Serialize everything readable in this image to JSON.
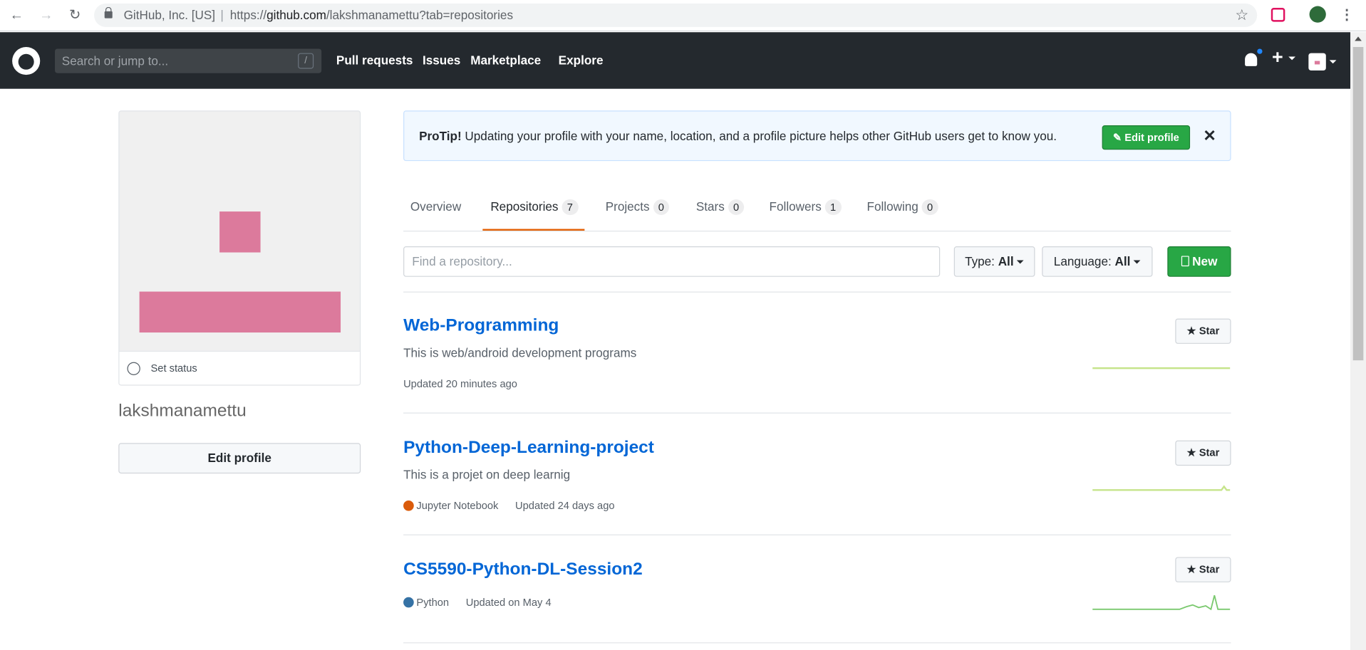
{
  "browser": {
    "org": "GitHub, Inc. [US]",
    "url_prefix": "https://",
    "url_host": "github.com",
    "url_path": "/lakshmanamettu?tab=repositories",
    "icons": [
      "back-arrow-icon",
      "forward-arrow-icon",
      "reload-icon",
      "lock-icon",
      "bookmark-star-icon",
      "pocket-extension-icon",
      "profile-avatar-icon",
      "kebab-menu-icon"
    ]
  },
  "header": {
    "search_placeholder": "Search or jump to...",
    "search_shortcut": "/",
    "nav": [
      "Pull requests",
      "Issues",
      "Marketplace",
      "Explore"
    ]
  },
  "profile": {
    "set_status": "Set status",
    "username": "lakshmanamettu",
    "edit_profile": "Edit profile"
  },
  "protip": {
    "label": "ProTip!",
    "text": " Updating your profile with your name, location, and a profile picture helps other GitHub users get to know you.",
    "button": "Edit profile",
    "close": "✕"
  },
  "tabs": [
    {
      "label": "Overview",
      "count": null
    },
    {
      "label": "Repositories",
      "count": "7"
    },
    {
      "label": "Projects",
      "count": "0"
    },
    {
      "label": "Stars",
      "count": "0"
    },
    {
      "label": "Followers",
      "count": "1"
    },
    {
      "label": "Following",
      "count": "0"
    }
  ],
  "filter": {
    "find_placeholder": "Find a repository...",
    "type_label": "Type:",
    "type_value": "All",
    "language_label": "Language:",
    "language_value": "All",
    "new_button": "New"
  },
  "repos": [
    {
      "name": "Web-Programming",
      "description": "This is web/android development programs",
      "language": "",
      "updated": "Updated 20 minutes ago",
      "star": "Star"
    },
    {
      "name": "Python-Deep-Learning-project",
      "description": "This is a projet on deep learnig",
      "language": "Jupyter Notebook",
      "updated": "Updated 24 days ago",
      "star": "Star"
    },
    {
      "name": "CS5590-Python-DL-Session2",
      "description": "",
      "language": "Python",
      "updated": "Updated on May 4",
      "star": "Star"
    }
  ],
  "colors": {
    "header_bg": "#24292e",
    "link": "#0366d6",
    "green": "#28a745",
    "tab_accent": "#e36209",
    "jupyter": "#DA5B0B",
    "python": "#3572A5",
    "avatar_pink": "#dc7a9c"
  }
}
